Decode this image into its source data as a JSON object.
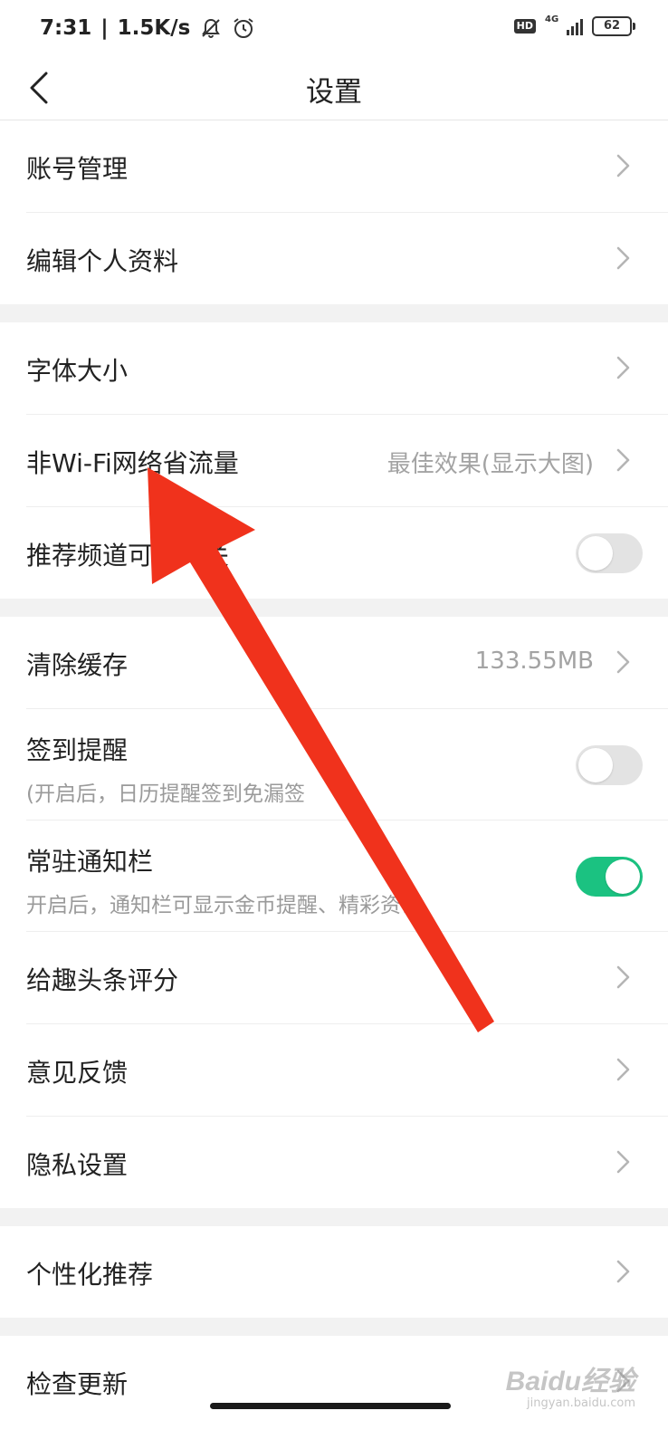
{
  "status_bar": {
    "time": "7:31",
    "net_speed": "1.5K/s",
    "hd": "HD",
    "network": "4G",
    "battery": "62"
  },
  "header": {
    "title": "设置"
  },
  "groups": [
    {
      "items": [
        {
          "label": "账号管理",
          "control": "chevron"
        },
        {
          "label": "编辑个人资料",
          "control": "chevron"
        }
      ]
    },
    {
      "items": [
        {
          "label": "字体大小",
          "control": "chevron"
        },
        {
          "label": "非Wi-Fi网络省流量",
          "value": "最佳效果(显示大图)",
          "control": "chevron"
        },
        {
          "label": "推荐频道可见开关",
          "control": "toggle",
          "on": false
        }
      ]
    },
    {
      "items": [
        {
          "label": "清除缓存",
          "value": "133.55MB",
          "control": "chevron"
        },
        {
          "label": "签到提醒",
          "subtitle": "(开启后，日历提醒签到免漏签",
          "control": "toggle",
          "on": false
        },
        {
          "label": "常驻通知栏",
          "subtitle": "开启后，通知栏可显示金币提醒、精彩资讯",
          "control": "toggle",
          "on": true
        },
        {
          "label": "给趣头条评分",
          "control": "chevron"
        },
        {
          "label": "意见反馈",
          "control": "chevron"
        },
        {
          "label": "隐私设置",
          "control": "chevron"
        }
      ]
    },
    {
      "items": [
        {
          "label": "个性化推荐",
          "control": "chevron"
        }
      ]
    },
    {
      "items": [
        {
          "label": "检查更新",
          "control": "chevron"
        }
      ]
    }
  ],
  "watermark": {
    "main": "Baidu经验",
    "sub": "jingyan.baidu.com"
  },
  "colors": {
    "toggle_on": "#1bc281",
    "toggle_off": "#e3e3e3",
    "annotation_arrow": "#f0321c",
    "group_gap": "#f2f2f2"
  }
}
